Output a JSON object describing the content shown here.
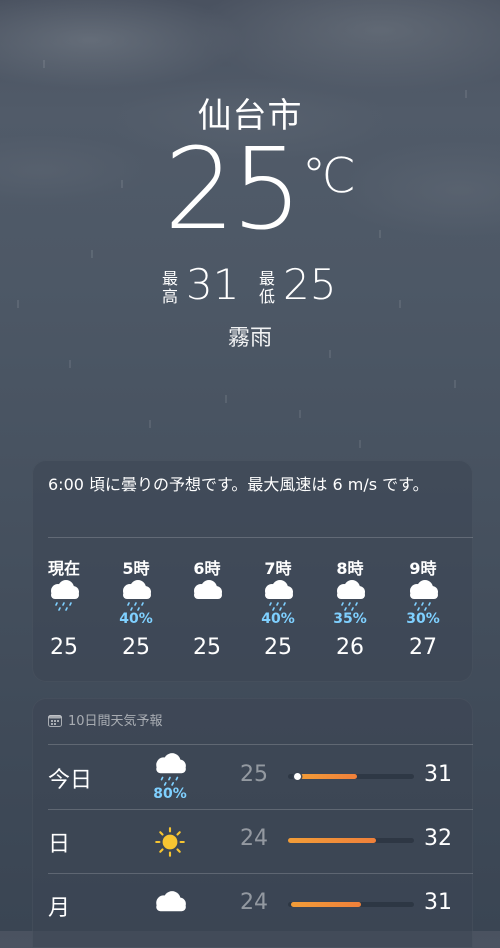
{
  "location": {
    "city": "仙台市",
    "current_temp": "25",
    "unit": "℃",
    "high_label": "最高",
    "high_value": "31",
    "low_label": "最低",
    "low_value": "25",
    "condition": "霧雨"
  },
  "hourly": {
    "summary": "6:00 頃に曇りの予想です。最大風速は 6 m/s です。",
    "hours": [
      {
        "label": "現在",
        "icon": "rain-cloud-icon",
        "pop": "",
        "temp": "25"
      },
      {
        "label": "5時",
        "icon": "rain-cloud-icon",
        "pop": "40%",
        "temp": "25"
      },
      {
        "label": "6時",
        "icon": "cloud-icon",
        "pop": "",
        "temp": "25"
      },
      {
        "label": "7時",
        "icon": "rain-cloud-icon",
        "pop": "40%",
        "temp": "25"
      },
      {
        "label": "8時",
        "icon": "rain-cloud-icon",
        "pop": "35%",
        "temp": "26"
      },
      {
        "label": "9時",
        "icon": "rain-cloud-icon",
        "pop": "30%",
        "temp": "27"
      }
    ]
  },
  "ten_day": {
    "header": "10日間天気予報",
    "days": [
      {
        "name": "今日",
        "icon": "rain-cloud-icon",
        "pop": "80%",
        "low": "25",
        "high": "31",
        "range_start": 0.08,
        "range_end": 0.55,
        "current": 0.07
      },
      {
        "name": "日",
        "icon": "sun-icon",
        "pop": "",
        "low": "24",
        "high": "32",
        "range_start": 0.0,
        "range_end": 0.7,
        "current": null
      },
      {
        "name": "月",
        "icon": "cloud-icon",
        "pop": "",
        "low": "24",
        "high": "31",
        "range_start": 0.02,
        "range_end": 0.58,
        "current": null
      }
    ]
  },
  "colors": {
    "precip": "#7fd0ff",
    "bar": "#f0803a",
    "sun": "#f7c531"
  }
}
